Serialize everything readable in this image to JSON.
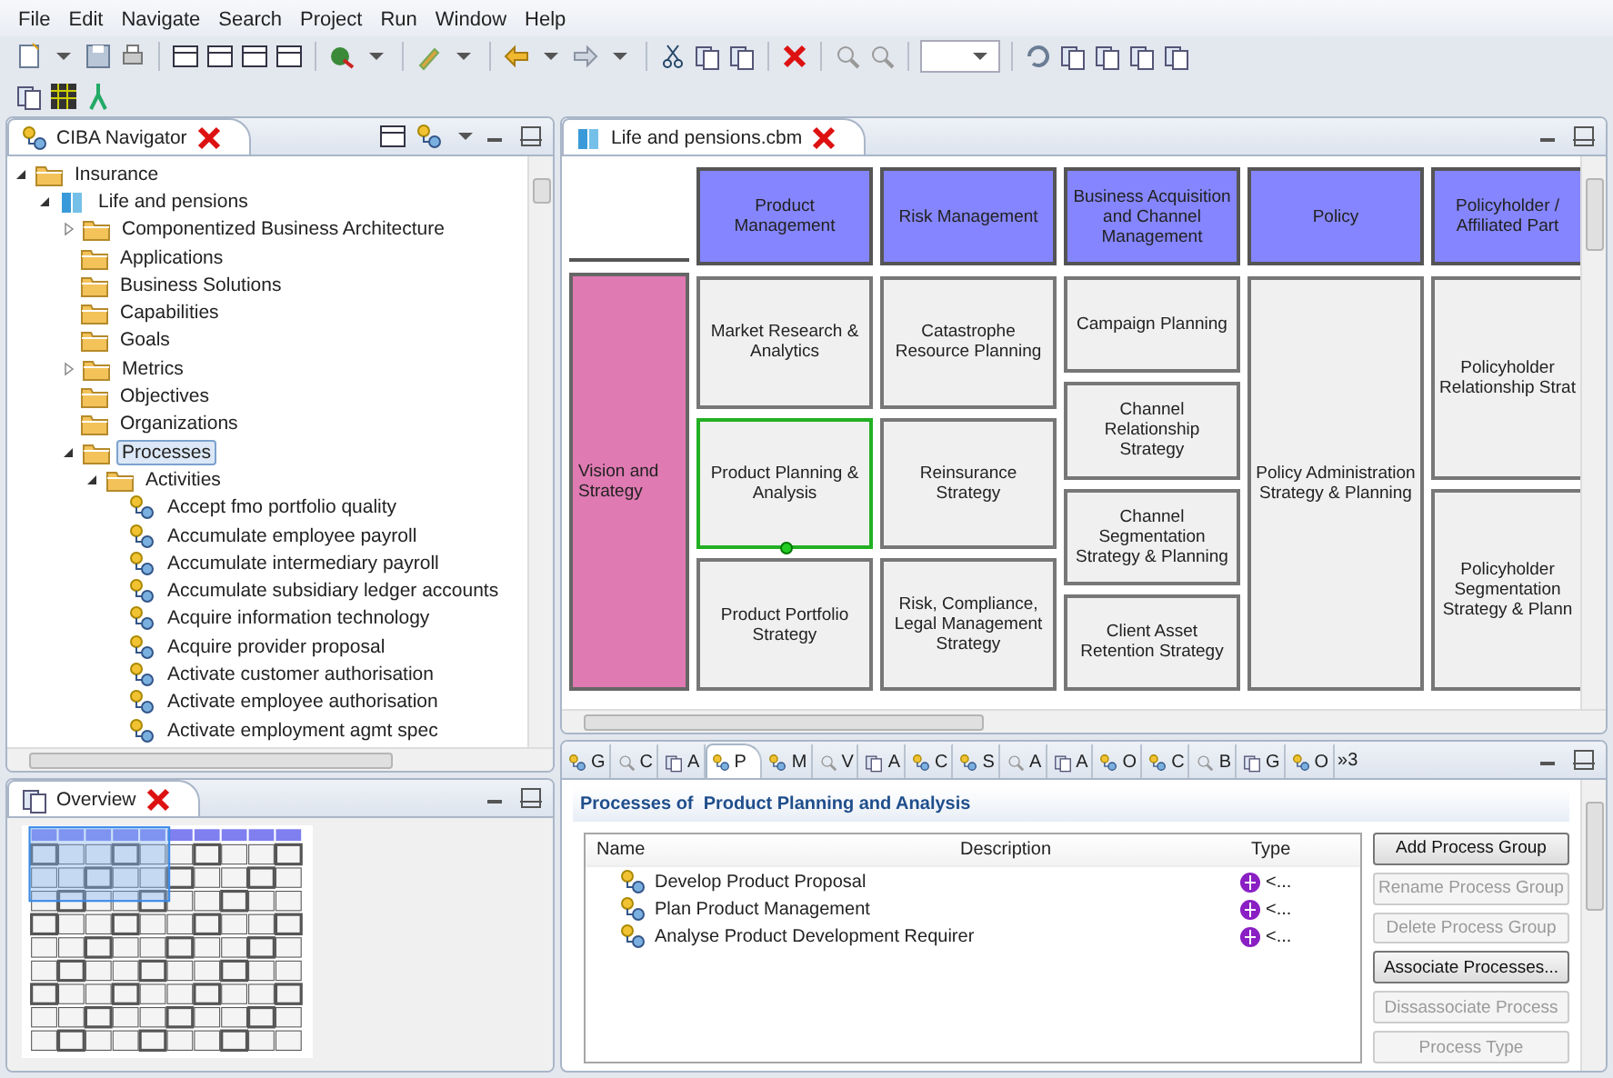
{
  "menu": [
    "File",
    "Edit",
    "Navigate",
    "Search",
    "Project",
    "Run",
    "Window",
    "Help"
  ],
  "navigator": {
    "title": "CIBA Navigator",
    "tree": [
      {
        "label": "Insurance",
        "expanded": true,
        "selected": false,
        "children": [
          {
            "label": "Life and pensions",
            "expanded": true,
            "selected": false,
            "children": [
              {
                "label": "Componentized Business Architecture",
                "expanded": false,
                "selected": false
              },
              {
                "label": "Applications",
                "selected": false
              },
              {
                "label": "Business Solutions",
                "selected": false
              },
              {
                "label": "Capabilities",
                "selected": false
              },
              {
                "label": "Goals",
                "selected": false
              },
              {
                "label": "Metrics",
                "expanded": false,
                "selected": false
              },
              {
                "label": "Objectives",
                "selected": false
              },
              {
                "label": "Organizations",
                "selected": false
              },
              {
                "label": "Processes",
                "expanded": true,
                "selected": true,
                "children": [
                  {
                    "label": "Activities",
                    "expanded": true,
                    "selected": false,
                    "children": [
                      {
                        "label": "Accept fmo portfolio quality",
                        "selected": false
                      },
                      {
                        "label": "Accumulate employee payroll",
                        "selected": false
                      },
                      {
                        "label": "Accumulate intermediary payroll",
                        "selected": false
                      },
                      {
                        "label": "Accumulate subsidiary ledger accounts",
                        "selected": false
                      },
                      {
                        "label": "Acquire information technology",
                        "selected": false
                      },
                      {
                        "label": "Acquire provider proposal",
                        "selected": false
                      },
                      {
                        "label": "Activate customer authorisation",
                        "selected": false
                      },
                      {
                        "label": "Activate employee authorisation",
                        "selected": false
                      },
                      {
                        "label": "Activate employment agmt spec",
                        "selected": false
                      }
                    ]
                  }
                ]
              }
            ]
          }
        ]
      }
    ]
  },
  "overview": {
    "title": "Overview"
  },
  "editor": {
    "title": "Life and pensions.cbm",
    "row_label": "Vision and Strategy",
    "columns": [
      {
        "label": "Product Management",
        "cells": [
          {
            "label": "Market Research & Analytics",
            "selected": false
          },
          {
            "label": "Product Planning & Analysis",
            "selected": true
          },
          {
            "label": "Product Portfolio Strategy",
            "selected": false
          }
        ]
      },
      {
        "label": "Risk Management",
        "cells": [
          {
            "label": "Catastrophe Resource Planning",
            "selected": false
          },
          {
            "label": "Reinsurance Strategy",
            "selected": false
          },
          {
            "label": "Risk, Compliance, Legal Management Strategy",
            "selected": false
          }
        ]
      },
      {
        "label": "Business Acquisition and Channel Management",
        "cells": [
          {
            "label": "Campaign Planning",
            "selected": false
          },
          {
            "label": "Channel Relationship Strategy",
            "selected": false
          },
          {
            "label": "Channel Segmentation Strategy & Planning",
            "selected": false
          },
          {
            "label": "Client Asset Retention Strategy",
            "selected": false
          }
        ]
      },
      {
        "label": "Policy",
        "cells": [
          {
            "label": "Policy Administration Strategy & Planning",
            "selected": false
          }
        ]
      },
      {
        "label": "Policyholder / Affiliated Part",
        "cells": [
          {
            "label": "Policyholder Relationship Strat",
            "selected": false
          },
          {
            "label": "Policyholder Segmentation Strategy & Plann",
            "selected": false
          }
        ]
      }
    ]
  },
  "bottom": {
    "tabs": [
      {
        "label": "G",
        "selected": false
      },
      {
        "label": "C",
        "selected": false
      },
      {
        "label": "A",
        "selected": false
      },
      {
        "label": "P",
        "selected": true
      },
      {
        "label": "M",
        "selected": false
      },
      {
        "label": "V",
        "selected": false
      },
      {
        "label": "A",
        "selected": false
      },
      {
        "label": "C",
        "selected": false
      },
      {
        "label": "S",
        "selected": false
      },
      {
        "label": "A",
        "selected": false
      },
      {
        "label": "A",
        "selected": false
      },
      {
        "label": "O",
        "selected": false
      },
      {
        "label": "C",
        "selected": false
      },
      {
        "label": "B",
        "selected": false
      },
      {
        "label": "G",
        "selected": false
      },
      {
        "label": "O",
        "selected": false
      }
    ],
    "more": "»3",
    "heading": "Processes of  Product Planning and Analysis",
    "table": {
      "columns": [
        "Name",
        "Description",
        "Type"
      ],
      "rows": [
        {
          "name": "Develop Product Proposal",
          "type": "<..."
        },
        {
          "name": "Plan Product Management",
          "type": "<..."
        },
        {
          "name": "Analyse Product Development Requirer",
          "type": "<..."
        }
      ]
    },
    "buttons": [
      {
        "label": "Add Process Group",
        "disabled": false
      },
      {
        "label": "Rename Process Group",
        "disabled": true
      },
      {
        "label": "Delete Process Group",
        "disabled": true
      },
      {
        "label": "Associate Processes...",
        "disabled": false
      },
      {
        "label": "Dissassociate Process",
        "disabled": true
      },
      {
        "label": "Process Type",
        "disabled": true
      }
    ]
  }
}
